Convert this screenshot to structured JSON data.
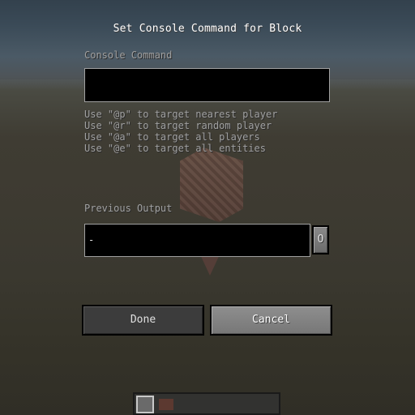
{
  "dialog": {
    "title": "Set Console Command for Block",
    "command_label": "Console Command",
    "command_value": "",
    "hints": [
      "Use \"@p\" to target nearest player",
      "Use \"@r\" to target random player",
      "Use \"@a\" to target all players",
      "Use \"@e\" to target all entities"
    ],
    "previous_output_label": "Previous Output",
    "previous_output_value": "-",
    "track_output_toggle": "O",
    "done_label": "Done",
    "cancel_label": "Cancel"
  },
  "colors": {
    "label_gray": "#a0a0a0",
    "field_background": "#000000",
    "title_white": "#ffffff"
  }
}
